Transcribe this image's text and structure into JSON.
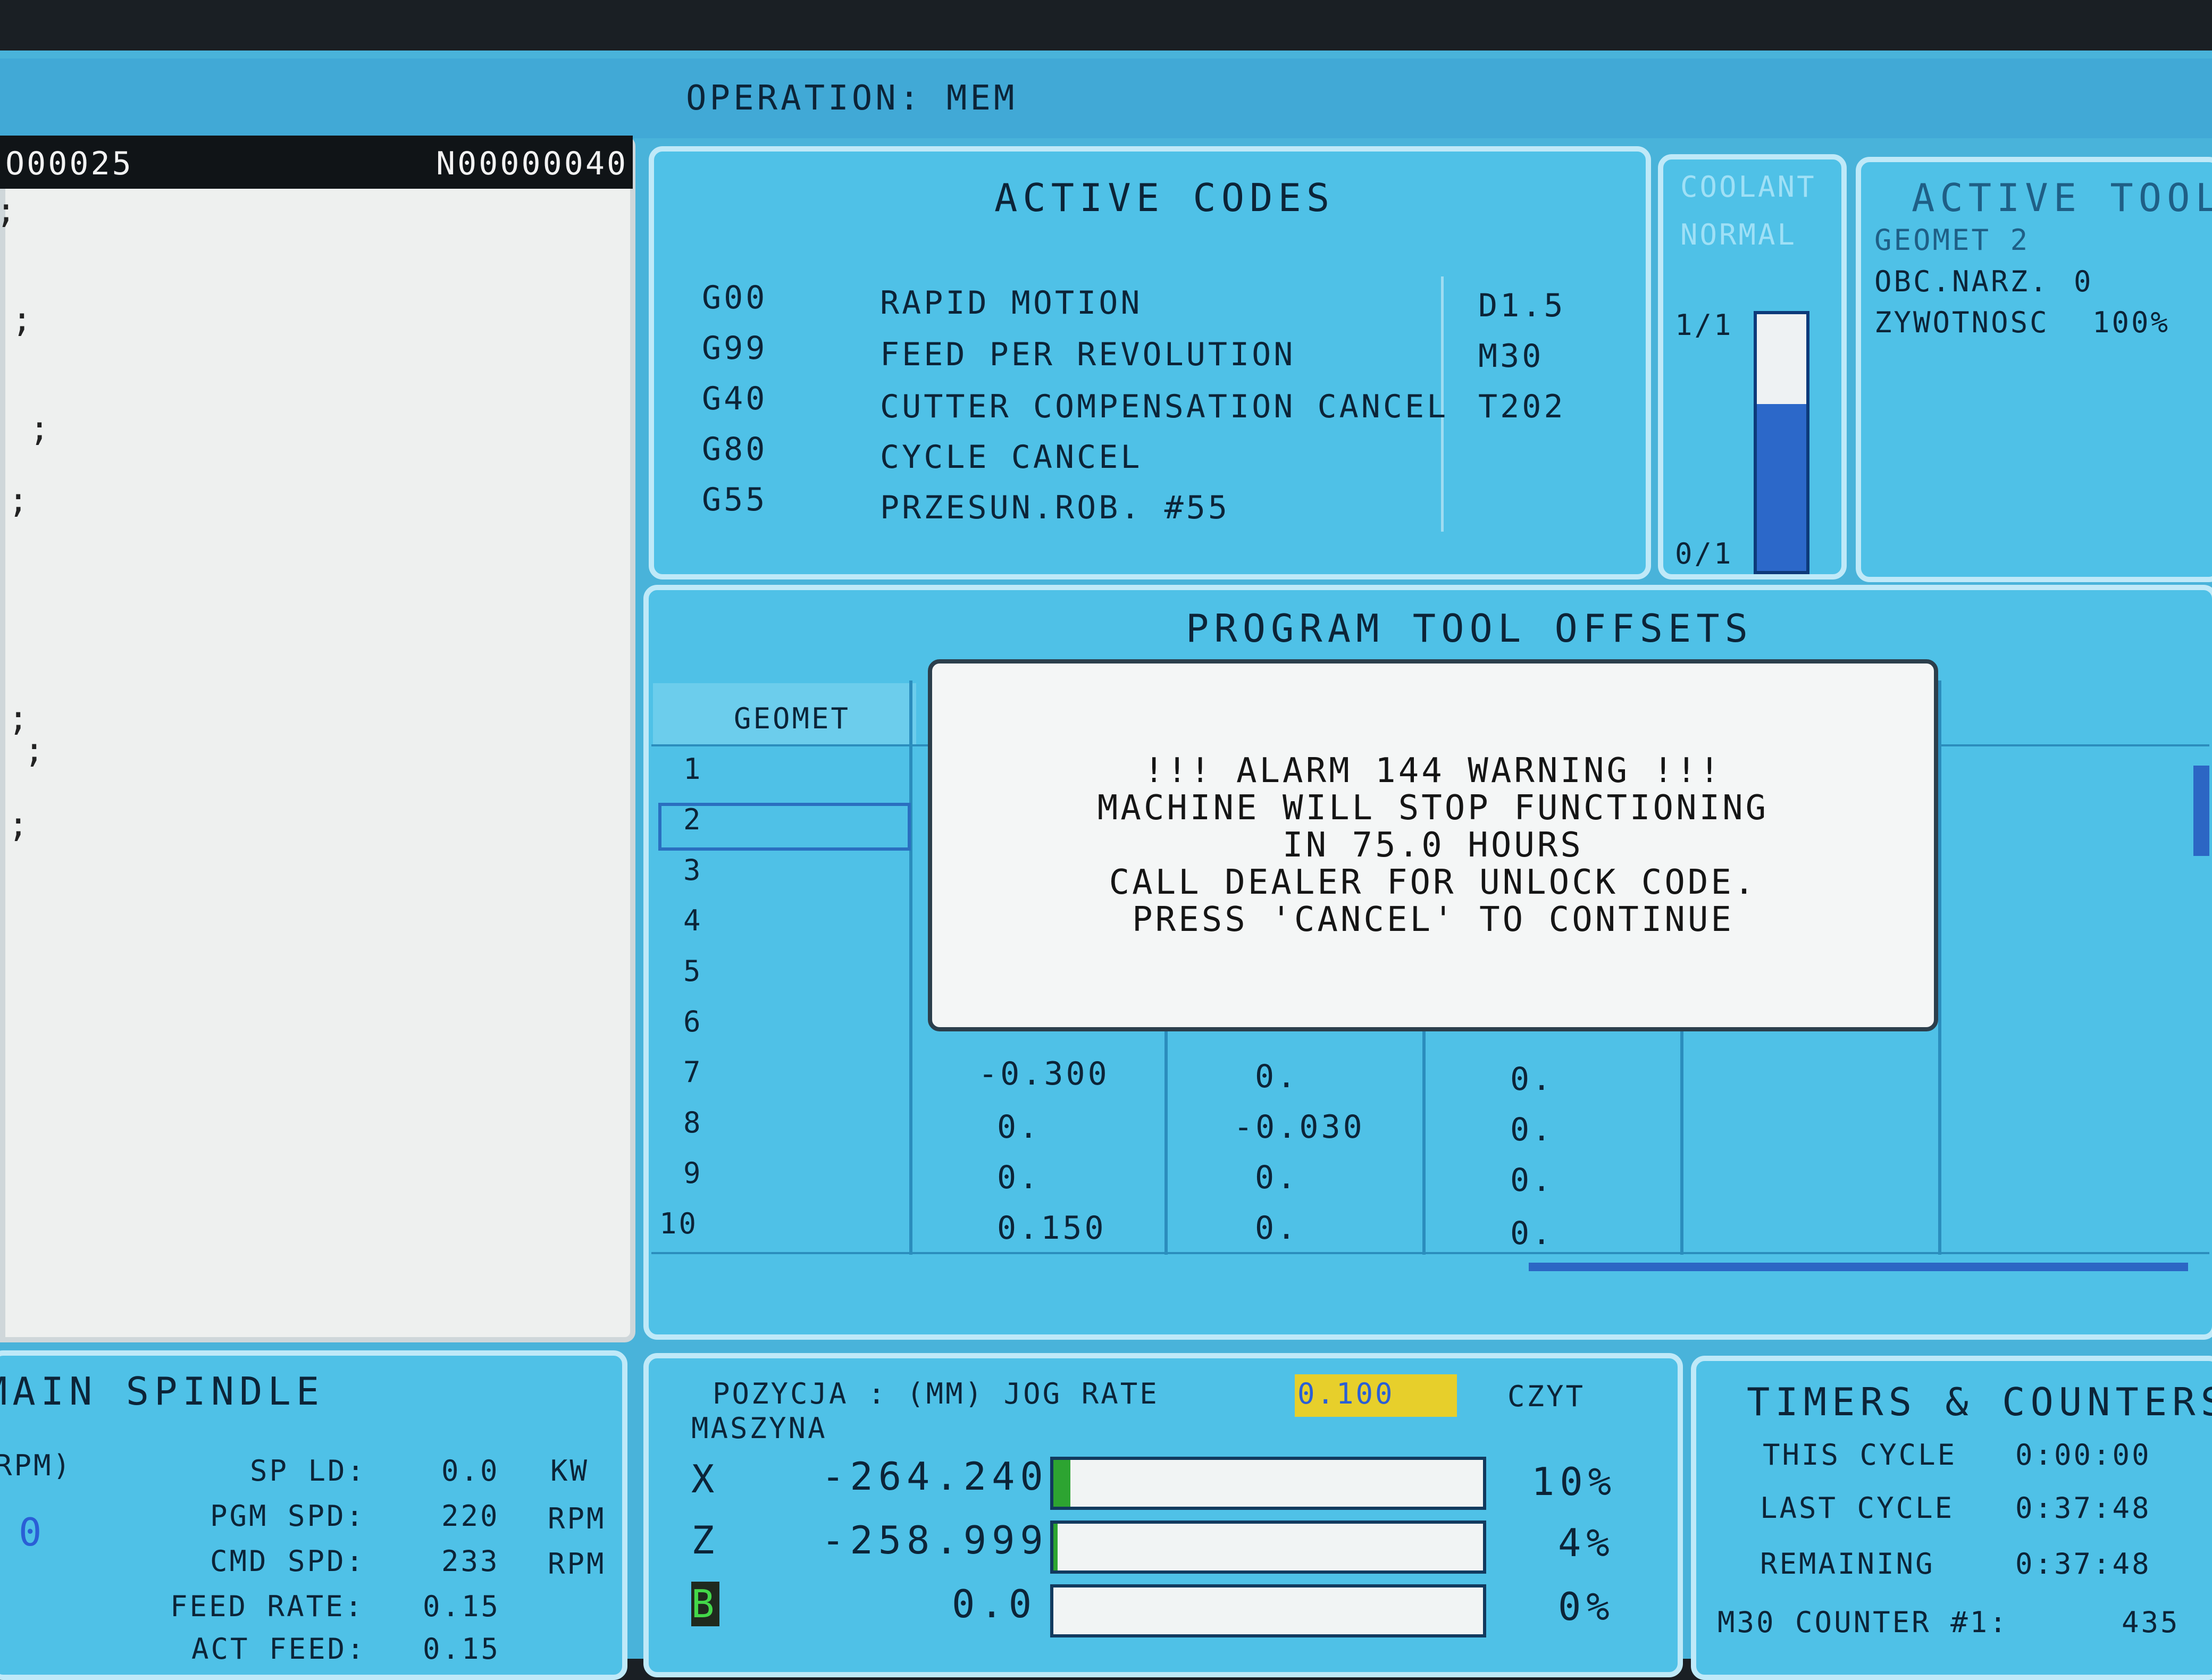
{
  "topbar": {
    "operation": "OPERATION: MEM"
  },
  "program": {
    "number": "O00025",
    "line": "N00000040"
  },
  "active_codes": {
    "title": "ACTIVE CODES",
    "rows": [
      {
        "code": "G00",
        "desc": "RAPID MOTION"
      },
      {
        "code": "G99",
        "desc": "FEED PER REVOLUTION"
      },
      {
        "code": "G40",
        "desc": "CUTTER COMPENSATION CANCEL"
      },
      {
        "code": "G80",
        "desc": "CYCLE CANCEL"
      },
      {
        "code": "G55",
        "desc": "PRZESUN.ROB. #55"
      }
    ],
    "side": [
      "D1.5",
      "M30",
      "T202"
    ]
  },
  "coolant": {
    "title": "COOLANT",
    "status": "NORMAL",
    "top": "1/1",
    "bottom": "0/1",
    "level": 0.65
  },
  "active_tool": {
    "title": "ACTIVE TOOL",
    "geomet": "GEOMET 2",
    "obc_label": "OBC.NARZ.",
    "obc_value": "0",
    "life_label": "ZYWOTNOSC",
    "life_value": "100%"
  },
  "offsets": {
    "title": "PROGRAM TOOL OFFSETS",
    "header": "GEOMET",
    "rows": [
      "1",
      "2",
      "3",
      "4",
      "5",
      "6",
      "7",
      "8",
      "9",
      "10"
    ],
    "visible": [
      {
        "x": "-0.300",
        "z": "0.",
        "r": "0."
      },
      {
        "x": "0.",
        "z": "-0.030",
        "r": "0."
      },
      {
        "x": "0.",
        "z": "0.",
        "r": "0."
      },
      {
        "x": "0.150",
        "z": "0.",
        "r": "0."
      }
    ]
  },
  "alarm": {
    "line1": "!!!   ALARM 144 WARNING   !!!",
    "line2": "MACHINE WILL STOP FUNCTIONING",
    "line3": "IN 75.0 HOURS",
    "line4": "CALL DEALER FOR UNLOCK CODE.",
    "line5": "PRESS 'CANCEL' TO CONTINUE"
  },
  "spindle": {
    "title": "MAIN SPINDLE",
    "rpm_label": "RPM)",
    "rpm_value": "0",
    "rows": [
      {
        "label": "SP LD:",
        "value": "0.0",
        "unit": "KW"
      },
      {
        "label": "PGM SPD:",
        "value": "220",
        "unit": "RPM"
      },
      {
        "label": "CMD SPD:",
        "value": "233",
        "unit": "RPM"
      },
      {
        "label": "FEED RATE:",
        "value": "0.15",
        "unit": ""
      },
      {
        "label": "ACT FEED:",
        "value": "0.15",
        "unit": ""
      }
    ]
  },
  "position": {
    "label": "POZYCJA : (MM) JOG RATE",
    "jog_rate": "0.100",
    "czyt": "CZYT",
    "mode": "MASZYNA",
    "axes": [
      {
        "axis": "X",
        "value": "-264.240",
        "load": "10%",
        "fill": 0.04
      },
      {
        "axis": "Z",
        "value": "-258.999",
        "load": "4%",
        "fill": 0.01
      },
      {
        "axis": "B",
        "value": "0.0",
        "load": "0%",
        "fill": 0.0
      }
    ]
  },
  "timers": {
    "title": "TIMERS & COUNTERS",
    "rows": [
      {
        "label": "THIS CYCLE",
        "value": "0:00:00"
      },
      {
        "label": "LAST CYCLE",
        "value": "0:37:48"
      },
      {
        "label": "REMAINING",
        "value": "0:37:48"
      },
      {
        "label": "M30 COUNTER #1:",
        "value": "435"
      }
    ]
  }
}
